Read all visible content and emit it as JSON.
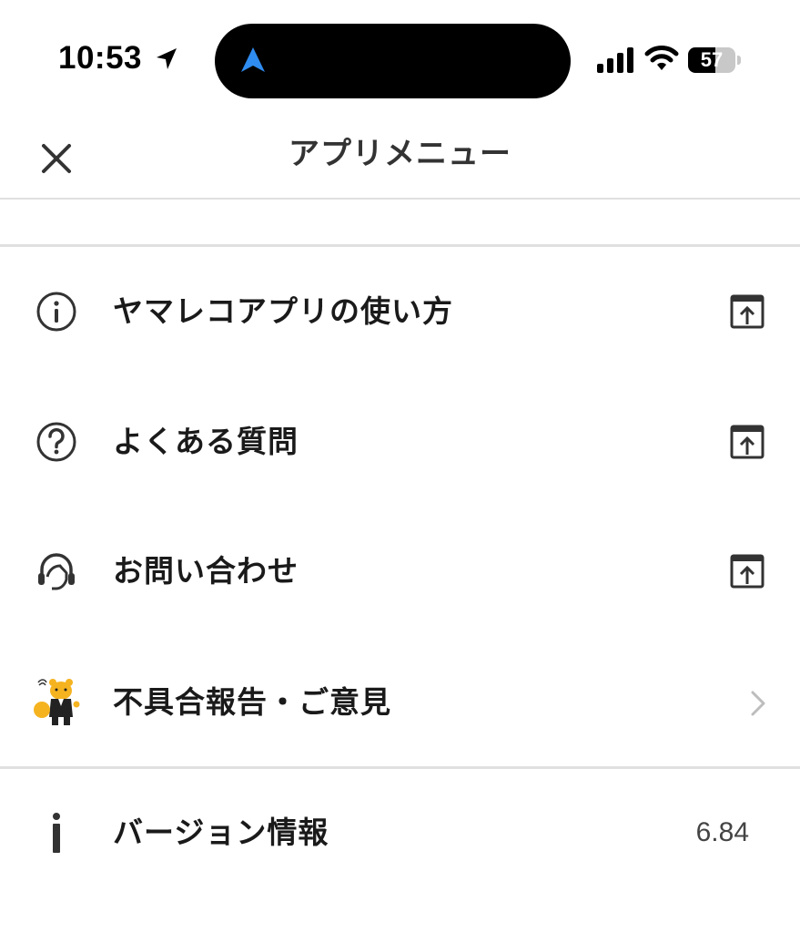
{
  "status_bar": {
    "time": "10:53",
    "battery_level": "57",
    "battery_fraction": 0.57
  },
  "header": {
    "title": "アプリメニュー",
    "close_icon": "close-icon"
  },
  "menu": {
    "items": [
      {
        "label": "ヤマレコアプリの使い方",
        "icon": "info-circle-icon",
        "trailing": "open-external-icon"
      },
      {
        "label": "よくある質問",
        "icon": "question-circle-icon",
        "trailing": "open-external-icon"
      },
      {
        "label": "お問い合わせ",
        "icon": "headset-support-icon",
        "trailing": "open-external-icon"
      },
      {
        "label": "不具合報告・ご意見",
        "icon": "mascot-bear-icon",
        "trailing": "chevron-right-icon"
      }
    ]
  },
  "version": {
    "label": "バージョン情報",
    "value": "6.84",
    "icon": "info-letter-icon"
  },
  "colors": {
    "text": "#1a1a1a",
    "icon": "#333333",
    "divider": "#e0e0e0",
    "accent_nav": "#2f8cf0",
    "mascot": "#f5b320"
  }
}
